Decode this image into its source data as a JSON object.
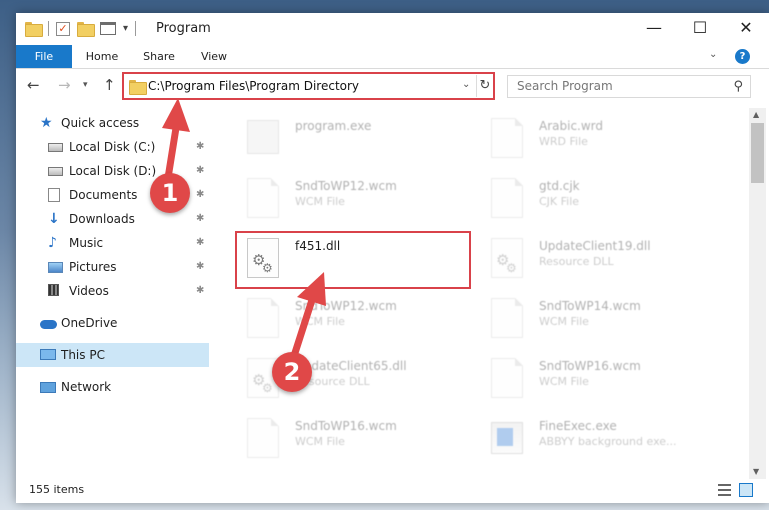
{
  "window": {
    "title": "Program",
    "controls": {
      "minimize": "—",
      "maximize": "☐",
      "close": "✕"
    }
  },
  "ribbon": {
    "tabs": [
      {
        "label": "File",
        "active": true
      },
      {
        "label": "Home"
      },
      {
        "label": "Share"
      },
      {
        "label": "View"
      }
    ],
    "help": "?"
  },
  "navigation": {
    "address": "C:\\Program Files\\Program Directory",
    "search_placeholder": "Search Program"
  },
  "sidebar": {
    "items": [
      {
        "label": "Quick access",
        "icon": "star-icon",
        "pinned": false
      },
      {
        "label": "Local Disk (C:)",
        "icon": "drive-icon",
        "pinned": true
      },
      {
        "label": "Local Disk (D:)",
        "icon": "drive-icon",
        "pinned": true
      },
      {
        "label": "Documents",
        "icon": "documents-icon",
        "pinned": true
      },
      {
        "label": "Downloads",
        "icon": "download-icon",
        "pinned": true
      },
      {
        "label": "Music",
        "icon": "music-icon",
        "pinned": true
      },
      {
        "label": "Pictures",
        "icon": "pictures-icon",
        "pinned": true
      },
      {
        "label": "Videos",
        "icon": "videos-icon",
        "pinned": true
      },
      {
        "label": "OneDrive",
        "icon": "onedrive-icon"
      },
      {
        "label": "This PC",
        "icon": "pc-icon",
        "selected": true
      },
      {
        "label": "Network",
        "icon": "network-icon"
      }
    ]
  },
  "files": [
    {
      "name": "program.exe",
      "type": "",
      "icon": "exe-icon"
    },
    {
      "name": "Arabic.wrd",
      "type": "WRD File",
      "icon": "document-icon"
    },
    {
      "name": "SndToWP12.wcm",
      "type": "WCM File",
      "icon": "document-icon"
    },
    {
      "name": "gtd.cjk",
      "type": "CJK File",
      "icon": "document-icon"
    },
    {
      "name": "f451.dll",
      "type": "",
      "icon": "dll-icon",
      "highlighted": true
    },
    {
      "name": "UpdateClient19.dll",
      "type": "Resource DLL",
      "icon": "dll-icon"
    },
    {
      "name": "SndToWP12.wcm",
      "type": "WCM File",
      "icon": "document-icon"
    },
    {
      "name": "SndToWP14.wcm",
      "type": "WCM File",
      "icon": "document-icon"
    },
    {
      "name": "UpdateClient65.dll",
      "type": "Resource DLL",
      "icon": "dll-icon"
    },
    {
      "name": "SndToWP16.wcm",
      "type": "WCM File",
      "icon": "document-icon"
    },
    {
      "name": "SndToWP16.wcm",
      "type": "WCM File",
      "icon": "document-icon"
    },
    {
      "name": "FineExec.exe",
      "type": "ABBYY background exe...",
      "icon": "app-icon"
    }
  ],
  "status": {
    "item_count": "155 items"
  },
  "annotations": [
    {
      "number": "1"
    },
    {
      "number": "2"
    }
  ],
  "colors": {
    "accent": "#1979ca",
    "highlight_border": "#d9424a",
    "callout": "#e04848",
    "selection": "#cce6f7"
  }
}
